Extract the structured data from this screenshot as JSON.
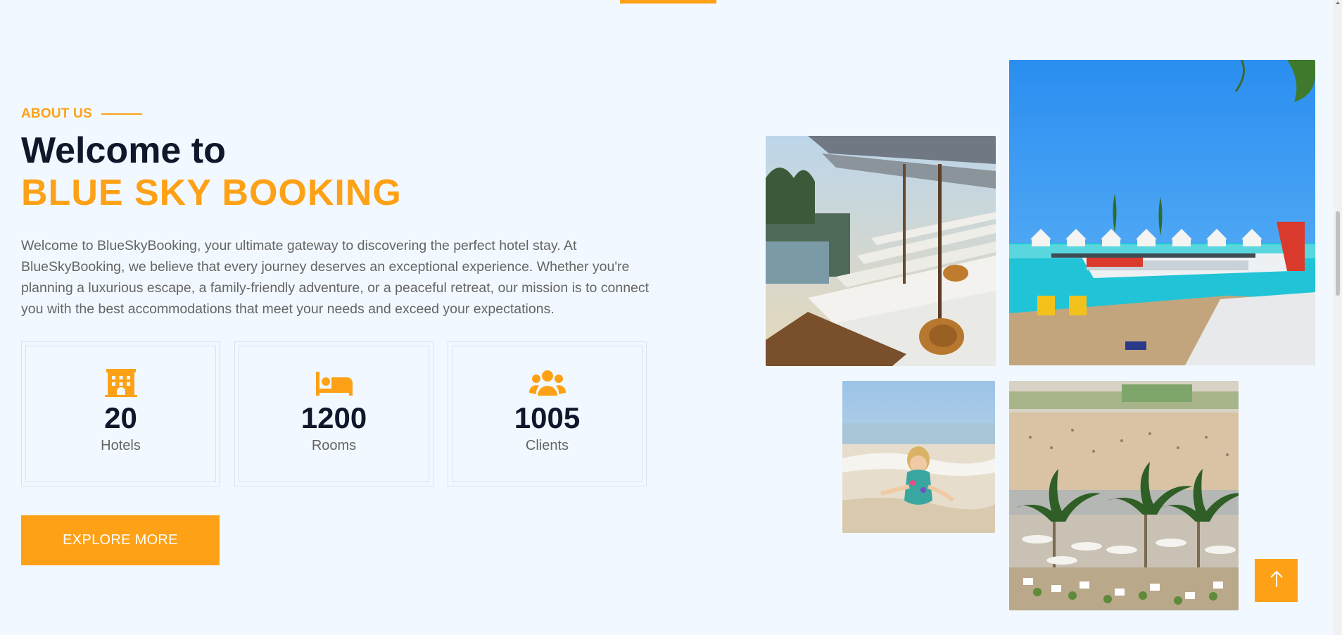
{
  "about": {
    "eyebrow": "ABOUT US",
    "title_line1": "Welcome to",
    "title_line2": "BLUE SKY BOOKING",
    "description": "Welcome to BlueSkyBooking, your ultimate gateway to discovering the perfect hotel stay. At BlueSkyBooking, we believe that every journey deserves an exceptional experience. Whether you're planning a luxurious escape, a family-friendly adventure, or a peaceful retreat, our mission is to connect you with the best accommodations that meet your needs and exceed your expectations."
  },
  "stats": [
    {
      "icon": "hotel-icon",
      "value": "20",
      "label": "Hotels"
    },
    {
      "icon": "bed-icon",
      "value": "1200",
      "label": "Rooms"
    },
    {
      "icon": "users-icon",
      "value": "1005",
      "label": "Clients"
    }
  ],
  "cta": {
    "label": "EXPLORE MORE"
  },
  "gallery": [
    {
      "icon": "photo-beach-loungers"
    },
    {
      "icon": "photo-seaplane-dock"
    },
    {
      "icon": "photo-child-on-beach"
    },
    {
      "icon": "photo-beach-restaurant"
    }
  ],
  "back_to_top": {
    "icon": "arrow-up-icon"
  },
  "colors": {
    "accent": "#fea116",
    "heading": "#0f172b",
    "body_text": "#666565",
    "background": "#f1f8ff"
  }
}
